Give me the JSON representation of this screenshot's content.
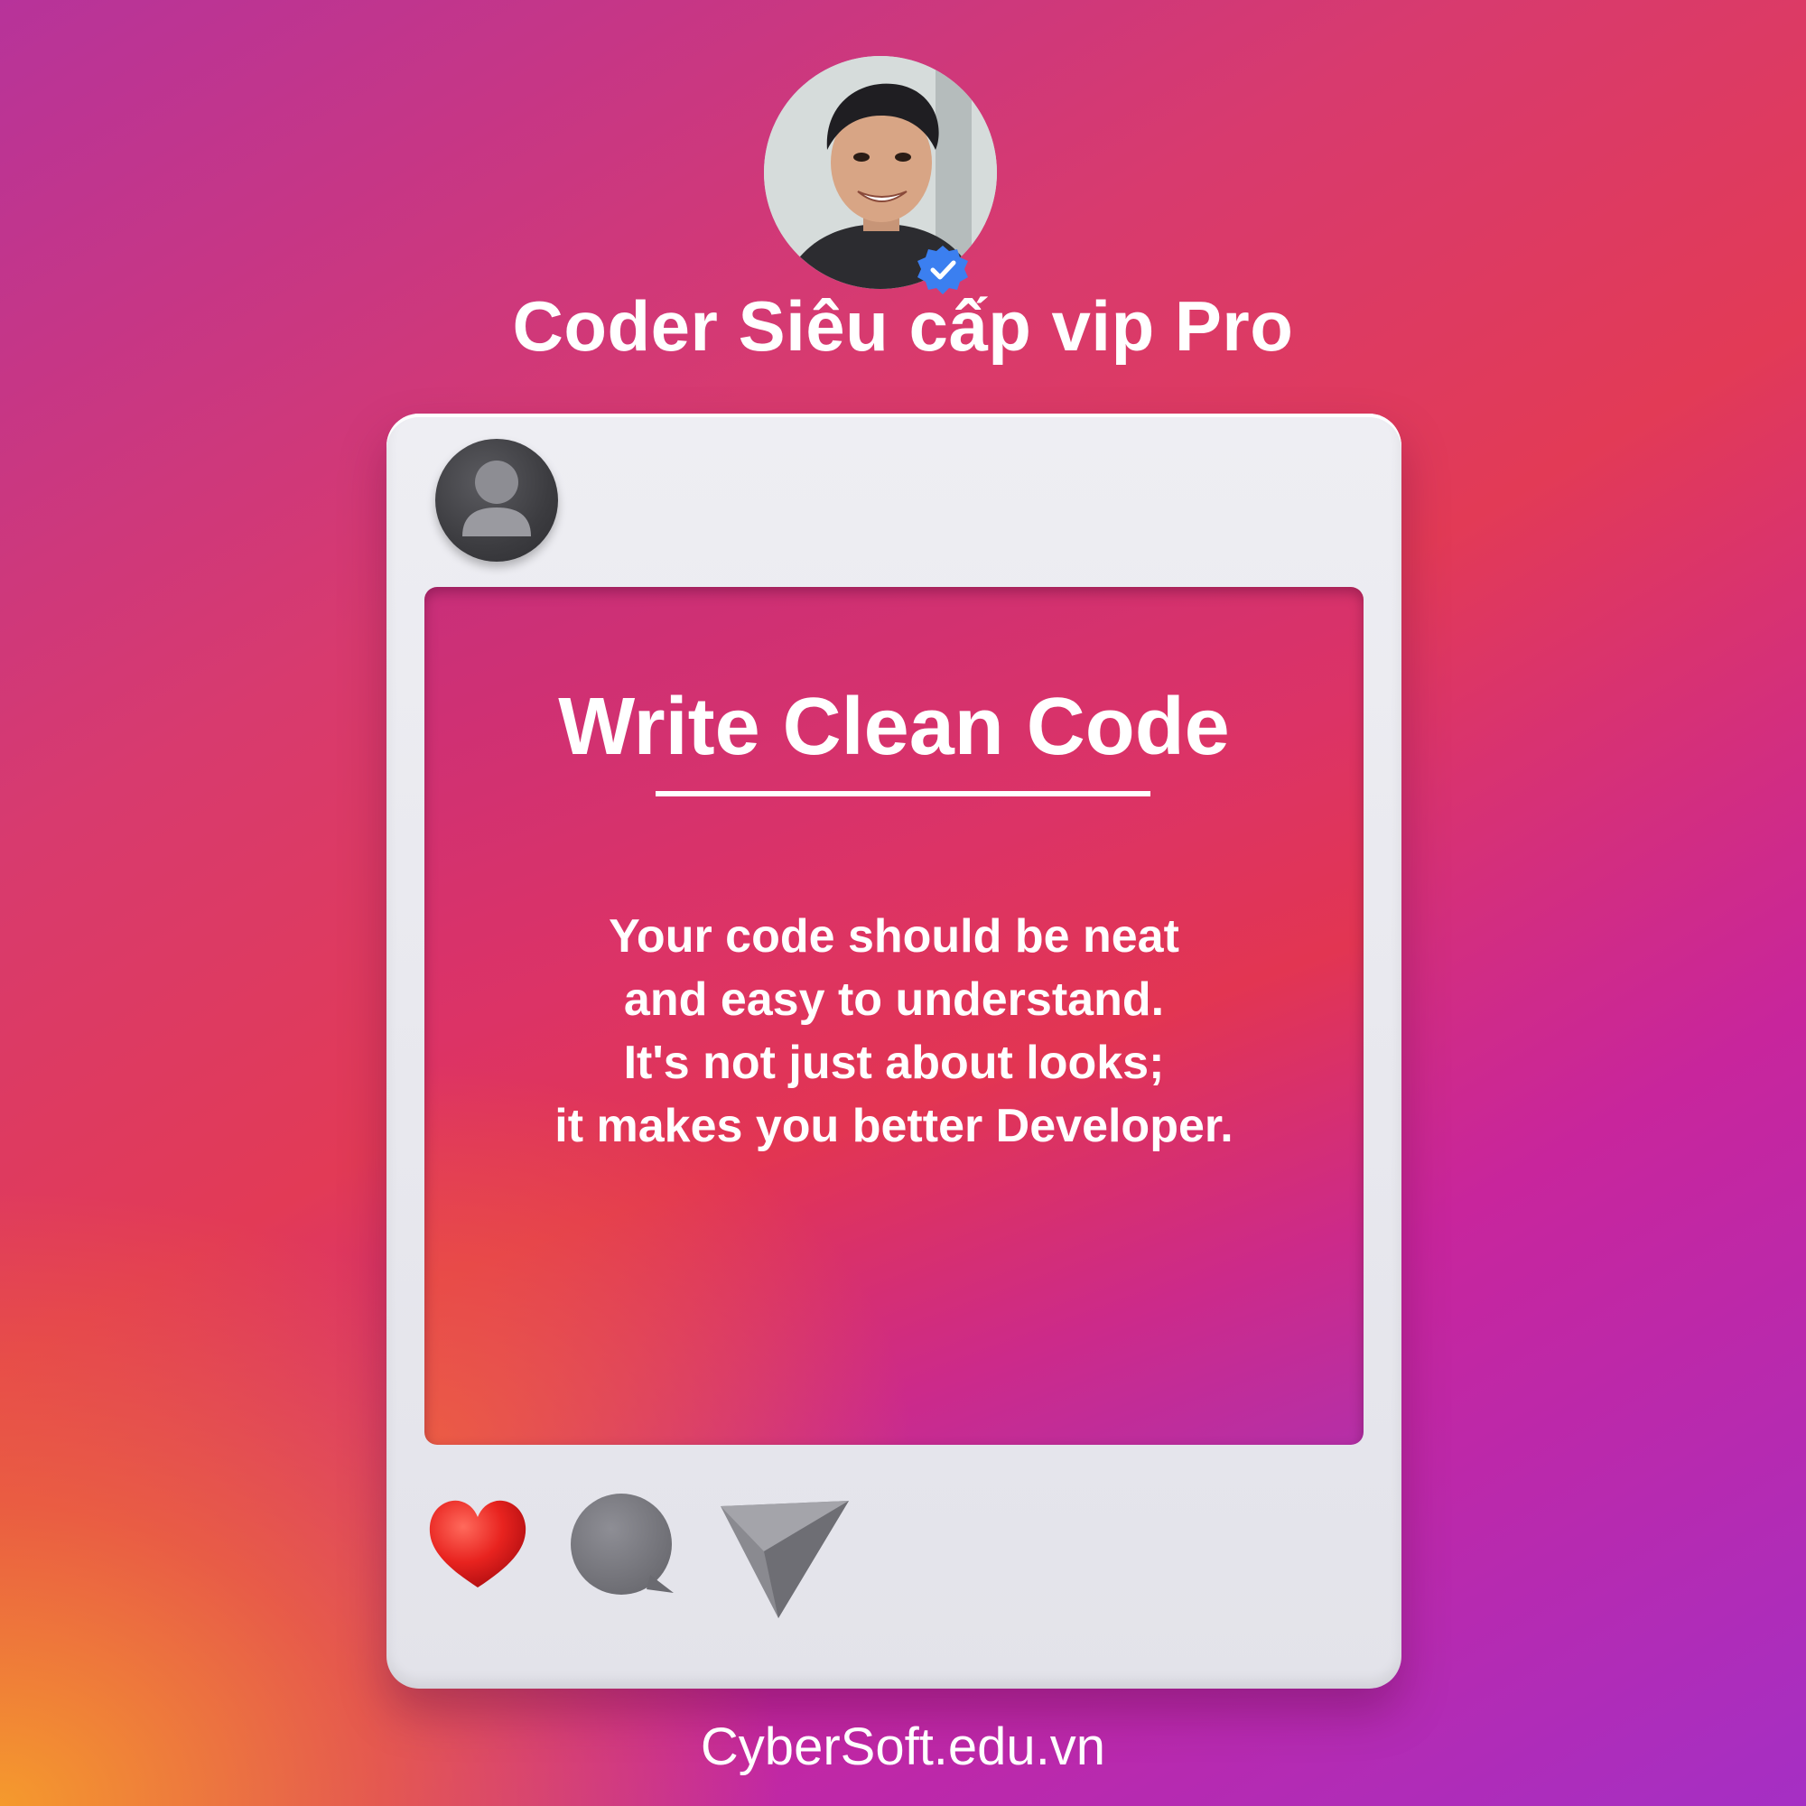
{
  "profile": {
    "name": "Coder Siêu cấp vip Pro",
    "avatar_icon": "profile-photo",
    "verified_icon": "verified-badge-icon"
  },
  "post": {
    "author_icon": "user-silhouette-icon",
    "title": "Write Clean Code",
    "body_lines": [
      "Your code should be neat",
      "and easy to understand.",
      "It's not just about looks;",
      "it makes you better Developer."
    ],
    "actions": [
      {
        "icon": "heart-icon",
        "color": "#e8231f"
      },
      {
        "icon": "comment-icon",
        "color": "#7a7a80"
      },
      {
        "icon": "send-icon",
        "color": "#8a8a90"
      }
    ]
  },
  "footer": {
    "site": "CyberSoft.edu.vn"
  },
  "colors": {
    "background_top": "#a52fc4",
    "background_mid": "#e23a56",
    "background_bottom_left": "#f7a028",
    "card": "#e8e8ee",
    "text": "#ffffff",
    "badge": "#3b7ff0"
  }
}
